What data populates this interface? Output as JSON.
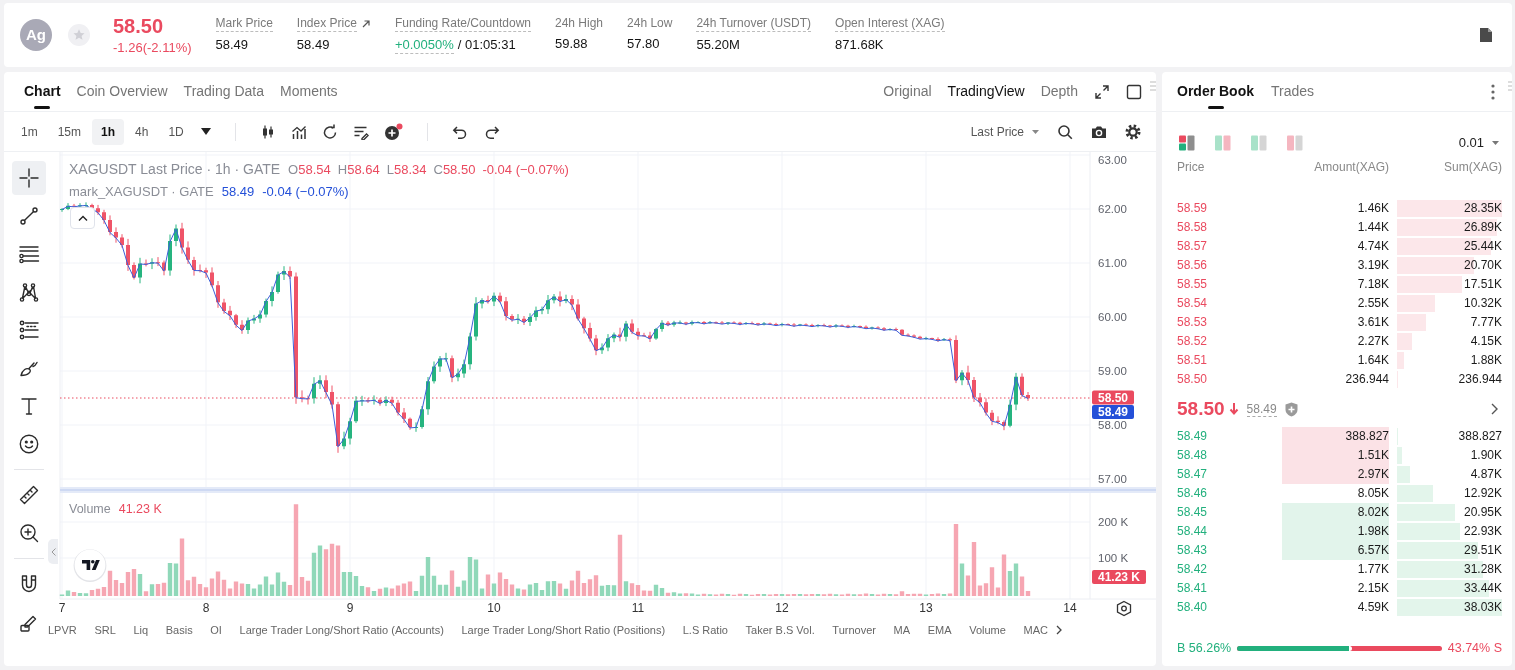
{
  "header": {
    "symbol": "Ag",
    "favorited": false,
    "last_price": "58.50",
    "change": "-1.26(-2.11%)",
    "falling": true,
    "stats": [
      {
        "label": "Mark Price",
        "underlined": true,
        "value": "58.49"
      },
      {
        "label": "Index Price",
        "underlined": true,
        "external": true,
        "value": "58.49"
      },
      {
        "label": "Funding Rate/Countdown",
        "underlined": true,
        "value": "+0.0050%",
        "value_rising": true,
        "value_underlined": true,
        "countdown": "/ 01:05:31"
      },
      {
        "label": "24h High",
        "underlined": false,
        "value": "59.88"
      },
      {
        "label": "24h Low",
        "underlined": false,
        "value": "57.80"
      },
      {
        "label": "24h Turnover (USDT)",
        "underlined": true,
        "value": "55.20M"
      },
      {
        "label": "Open Interest (XAG)",
        "underlined": true,
        "value": "871.68K"
      }
    ]
  },
  "chart_panel": {
    "tabs": [
      {
        "label": "Chart",
        "selected": true
      },
      {
        "label": "Coin Overview",
        "selected": false
      },
      {
        "label": "Trading Data",
        "selected": false
      },
      {
        "label": "Moments",
        "selected": false
      }
    ],
    "views": [
      {
        "label": "Original",
        "selected": false
      },
      {
        "label": "TradingView",
        "selected": true
      },
      {
        "label": "Depth",
        "selected": false
      }
    ],
    "intervals": [
      {
        "label": "1m",
        "selected": false
      },
      {
        "label": "15m",
        "selected": false
      },
      {
        "label": "1h",
        "selected": true
      },
      {
        "label": "4h",
        "selected": false
      },
      {
        "label": "1D",
        "selected": false
      }
    ],
    "price_source": "Last Price",
    "drawing_tools": [
      {
        "selected": true
      },
      {
        "selected": false
      },
      {
        "selected": false
      },
      {
        "selected": false
      },
      {
        "selected": false
      },
      {
        "selected": false
      },
      {
        "selected": false
      },
      {
        "selected": false
      },
      {
        "selected": false
      },
      {
        "selected": false
      },
      {
        "selected": false
      },
      {
        "selected": false
      }
    ],
    "last_candle_falling": true,
    "legend": {
      "title": "XAGUSDT Last Price · 1h · GATE",
      "ohlc": [
        {
          "key": "O",
          "value": "58.54"
        },
        {
          "key": "H",
          "value": "58.64"
        },
        {
          "key": "L",
          "value": "58.34"
        },
        {
          "key": "C",
          "value": "58.50"
        }
      ],
      "change": "-0.04 (−0.07%)",
      "mark_title": "mark_XAGUSDT · GATE",
      "mark_value": "58.49",
      "mark_change": "-0.04 (−0.07%)"
    },
    "price_axis": [
      "63.00",
      "62.00",
      "61.00",
      "60.00",
      "59.00",
      "58.00",
      "57.00"
    ],
    "last_price_tag": "58.50",
    "mark_price_tag": "58.49",
    "volume": {
      "title": "Volume",
      "value": "41.23 K",
      "axis": [
        "200 K",
        "100 K"
      ],
      "tag": "41.23 K"
    },
    "time_axis": [
      "7",
      "8",
      "9",
      "10",
      "11",
      "12",
      "13",
      "14"
    ],
    "indicators": [
      "LPVR",
      "SRL",
      "Liq",
      "Basis",
      "OI",
      "Large Trader Long/Short Ratio (Accounts)",
      "Large Trader Long/Short Ratio (Positions)",
      "L.S Ratio",
      "Taker B.S Vol.",
      "Turnover",
      "MA",
      "EMA",
      "Volume",
      "MAC"
    ]
  },
  "order_book": {
    "tabs": [
      {
        "label": "Order Book",
        "selected": true
      },
      {
        "label": "Trades",
        "selected": false
      }
    ],
    "view_modes": [
      {
        "selected": true
      },
      {
        "selected": false
      },
      {
        "selected": false
      },
      {
        "selected": false
      }
    ],
    "tick_size": "0.01",
    "columns": [
      "Price",
      "Amount(XAG)",
      "Sum(XAG)"
    ],
    "asks": [
      {
        "price": "58.59",
        "amount": "1.46K",
        "sum": "28.35K"
      },
      {
        "price": "58.58",
        "amount": "1.44K",
        "sum": "26.89K"
      },
      {
        "price": "58.57",
        "amount": "4.74K",
        "sum": "25.44K"
      },
      {
        "price": "58.56",
        "amount": "3.19K",
        "sum": "20.70K"
      },
      {
        "price": "58.55",
        "amount": "7.18K",
        "sum": "17.51K"
      },
      {
        "price": "58.54",
        "amount": "2.55K",
        "sum": "10.32K"
      },
      {
        "price": "58.53",
        "amount": "3.61K",
        "sum": "7.77K"
      },
      {
        "price": "58.52",
        "amount": "2.27K",
        "sum": "4.15K"
      },
      {
        "price": "58.51",
        "amount": "1.64K",
        "sum": "1.88K"
      },
      {
        "price": "58.50",
        "amount": "236.944",
        "sum": "236.944"
      }
    ],
    "last_price": "58.50",
    "falling": true,
    "mark_price": "58.49",
    "bids": [
      {
        "price": "58.49",
        "amount": "388.827",
        "sum": "388.827",
        "sell_highlight": true,
        "buy_highlight": false
      },
      {
        "price": "58.48",
        "amount": "1.51K",
        "sum": "1.90K",
        "sell_highlight": true,
        "buy_highlight": false
      },
      {
        "price": "58.47",
        "amount": "2.97K",
        "sum": "4.87K",
        "sell_highlight": true,
        "buy_highlight": false
      },
      {
        "price": "58.46",
        "amount": "8.05K",
        "sum": "12.92K",
        "sell_highlight": false,
        "buy_highlight": false
      },
      {
        "price": "58.45",
        "amount": "8.02K",
        "sum": "20.95K",
        "sell_highlight": false,
        "buy_highlight": true
      },
      {
        "price": "58.44",
        "amount": "1.98K",
        "sum": "22.93K",
        "sell_highlight": false,
        "buy_highlight": true
      },
      {
        "price": "58.43",
        "amount": "6.57K",
        "sum": "29.51K",
        "sell_highlight": false,
        "buy_highlight": true
      },
      {
        "price": "58.42",
        "amount": "1.77K",
        "sum": "31.28K",
        "sell_highlight": false,
        "buy_highlight": false
      },
      {
        "price": "58.41",
        "amount": "2.15K",
        "sum": "33.44K",
        "sell_highlight": false,
        "buy_highlight": false
      },
      {
        "price": "58.40",
        "amount": "4.59K",
        "sum": "38.03K",
        "sell_highlight": false,
        "buy_highlight": false
      }
    ],
    "ratio": {
      "buy": "B 56.26%",
      "sell": "43.74% S",
      "level": 0.5626
    }
  }
}
